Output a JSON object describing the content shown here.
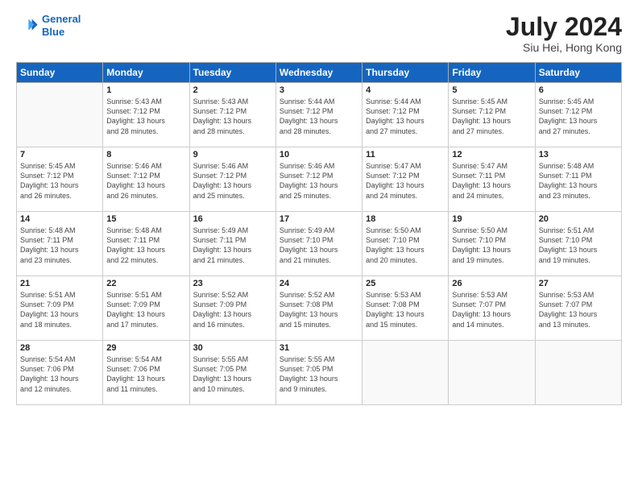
{
  "header": {
    "logo_line1": "General",
    "logo_line2": "Blue",
    "month_year": "July 2024",
    "location": "Siu Hei, Hong Kong"
  },
  "weekdays": [
    "Sunday",
    "Monday",
    "Tuesday",
    "Wednesday",
    "Thursday",
    "Friday",
    "Saturday"
  ],
  "weeks": [
    [
      {
        "day": "",
        "info": ""
      },
      {
        "day": "1",
        "info": "Sunrise: 5:43 AM\nSunset: 7:12 PM\nDaylight: 13 hours\nand 28 minutes."
      },
      {
        "day": "2",
        "info": "Sunrise: 5:43 AM\nSunset: 7:12 PM\nDaylight: 13 hours\nand 28 minutes."
      },
      {
        "day": "3",
        "info": "Sunrise: 5:44 AM\nSunset: 7:12 PM\nDaylight: 13 hours\nand 28 minutes."
      },
      {
        "day": "4",
        "info": "Sunrise: 5:44 AM\nSunset: 7:12 PM\nDaylight: 13 hours\nand 27 minutes."
      },
      {
        "day": "5",
        "info": "Sunrise: 5:45 AM\nSunset: 7:12 PM\nDaylight: 13 hours\nand 27 minutes."
      },
      {
        "day": "6",
        "info": "Sunrise: 5:45 AM\nSunset: 7:12 PM\nDaylight: 13 hours\nand 27 minutes."
      }
    ],
    [
      {
        "day": "7",
        "info": "Sunrise: 5:45 AM\nSunset: 7:12 PM\nDaylight: 13 hours\nand 26 minutes."
      },
      {
        "day": "8",
        "info": "Sunrise: 5:46 AM\nSunset: 7:12 PM\nDaylight: 13 hours\nand 26 minutes."
      },
      {
        "day": "9",
        "info": "Sunrise: 5:46 AM\nSunset: 7:12 PM\nDaylight: 13 hours\nand 25 minutes."
      },
      {
        "day": "10",
        "info": "Sunrise: 5:46 AM\nSunset: 7:12 PM\nDaylight: 13 hours\nand 25 minutes."
      },
      {
        "day": "11",
        "info": "Sunrise: 5:47 AM\nSunset: 7:12 PM\nDaylight: 13 hours\nand 24 minutes."
      },
      {
        "day": "12",
        "info": "Sunrise: 5:47 AM\nSunset: 7:11 PM\nDaylight: 13 hours\nand 24 minutes."
      },
      {
        "day": "13",
        "info": "Sunrise: 5:48 AM\nSunset: 7:11 PM\nDaylight: 13 hours\nand 23 minutes."
      }
    ],
    [
      {
        "day": "14",
        "info": "Sunrise: 5:48 AM\nSunset: 7:11 PM\nDaylight: 13 hours\nand 23 minutes."
      },
      {
        "day": "15",
        "info": "Sunrise: 5:48 AM\nSunset: 7:11 PM\nDaylight: 13 hours\nand 22 minutes."
      },
      {
        "day": "16",
        "info": "Sunrise: 5:49 AM\nSunset: 7:11 PM\nDaylight: 13 hours\nand 21 minutes."
      },
      {
        "day": "17",
        "info": "Sunrise: 5:49 AM\nSunset: 7:10 PM\nDaylight: 13 hours\nand 21 minutes."
      },
      {
        "day": "18",
        "info": "Sunrise: 5:50 AM\nSunset: 7:10 PM\nDaylight: 13 hours\nand 20 minutes."
      },
      {
        "day": "19",
        "info": "Sunrise: 5:50 AM\nSunset: 7:10 PM\nDaylight: 13 hours\nand 19 minutes."
      },
      {
        "day": "20",
        "info": "Sunrise: 5:51 AM\nSunset: 7:10 PM\nDaylight: 13 hours\nand 19 minutes."
      }
    ],
    [
      {
        "day": "21",
        "info": "Sunrise: 5:51 AM\nSunset: 7:09 PM\nDaylight: 13 hours\nand 18 minutes."
      },
      {
        "day": "22",
        "info": "Sunrise: 5:51 AM\nSunset: 7:09 PM\nDaylight: 13 hours\nand 17 minutes."
      },
      {
        "day": "23",
        "info": "Sunrise: 5:52 AM\nSunset: 7:09 PM\nDaylight: 13 hours\nand 16 minutes."
      },
      {
        "day": "24",
        "info": "Sunrise: 5:52 AM\nSunset: 7:08 PM\nDaylight: 13 hours\nand 15 minutes."
      },
      {
        "day": "25",
        "info": "Sunrise: 5:53 AM\nSunset: 7:08 PM\nDaylight: 13 hours\nand 15 minutes."
      },
      {
        "day": "26",
        "info": "Sunrise: 5:53 AM\nSunset: 7:07 PM\nDaylight: 13 hours\nand 14 minutes."
      },
      {
        "day": "27",
        "info": "Sunrise: 5:53 AM\nSunset: 7:07 PM\nDaylight: 13 hours\nand 13 minutes."
      }
    ],
    [
      {
        "day": "28",
        "info": "Sunrise: 5:54 AM\nSunset: 7:06 PM\nDaylight: 13 hours\nand 12 minutes."
      },
      {
        "day": "29",
        "info": "Sunrise: 5:54 AM\nSunset: 7:06 PM\nDaylight: 13 hours\nand 11 minutes."
      },
      {
        "day": "30",
        "info": "Sunrise: 5:55 AM\nSunset: 7:05 PM\nDaylight: 13 hours\nand 10 minutes."
      },
      {
        "day": "31",
        "info": "Sunrise: 5:55 AM\nSunset: 7:05 PM\nDaylight: 13 hours\nand 9 minutes."
      },
      {
        "day": "",
        "info": ""
      },
      {
        "day": "",
        "info": ""
      },
      {
        "day": "",
        "info": ""
      }
    ]
  ]
}
